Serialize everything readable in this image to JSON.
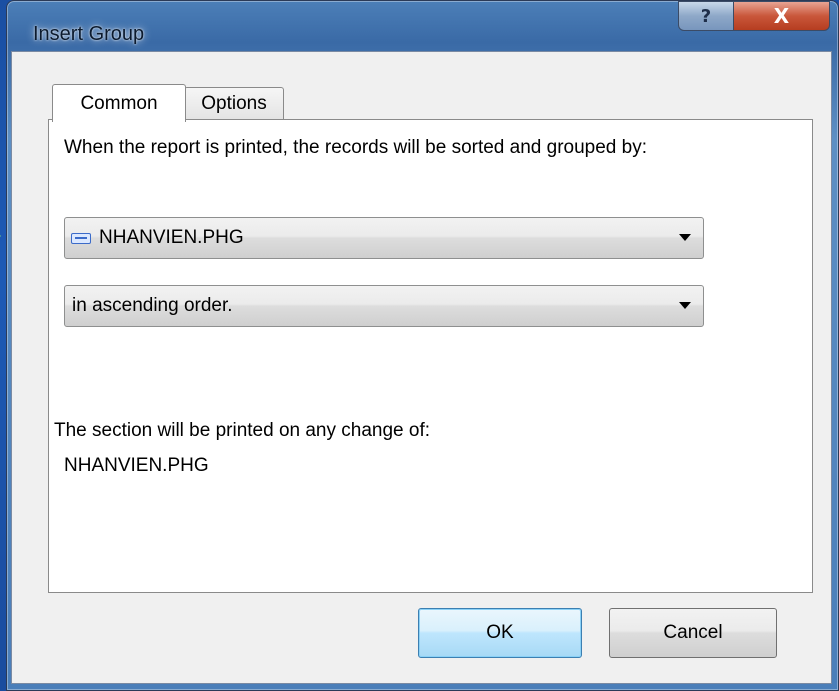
{
  "window": {
    "title": "Insert Group",
    "help_glyph": "?",
    "close_glyph": "X"
  },
  "tabs": [
    {
      "label": "Common",
      "selected": true
    },
    {
      "label": "Options",
      "selected": false
    }
  ],
  "common": {
    "sort_description": "When the report is printed, the records will be sorted and grouped by:",
    "group_field": {
      "value": "NHANVIEN.PHG",
      "icon": "database-field-icon"
    },
    "sort_order": {
      "value": "in ascending order."
    },
    "section_label": "The section will be printed on any change of:",
    "section_value": "NHANVIEN.PHG"
  },
  "buttons": {
    "ok_label": "OK",
    "cancel_label": "Cancel"
  },
  "colors": {
    "desktop": "#1d5ab5",
    "close_button": "#c9573b",
    "default_button_border": "#3c7fb1"
  }
}
